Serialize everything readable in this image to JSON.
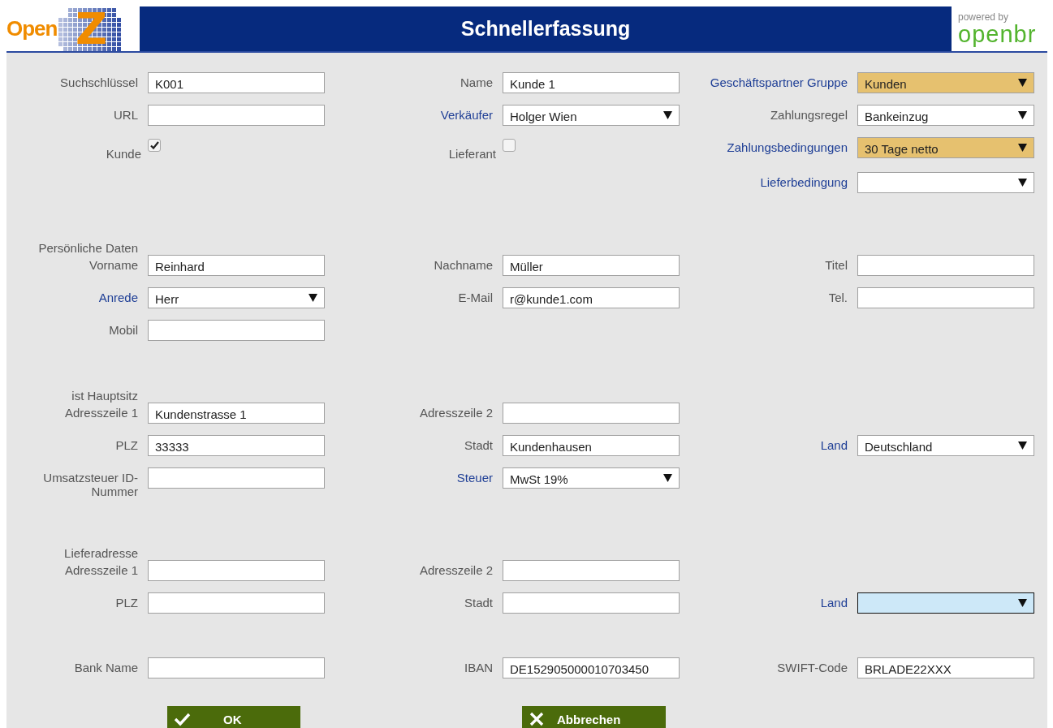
{
  "header": {
    "logo_text": "Open",
    "logo_letter": "Z",
    "title": "Schnellerfassung",
    "powered_by": "powered by",
    "partner_logo": "openbr"
  },
  "sections": [
    {
      "rows": [
        {
          "left": {
            "label": "Suchschlüssel",
            "linked": false,
            "kind": "text",
            "value": "K001"
          },
          "middle": {
            "label": "Name",
            "linked": false,
            "kind": "text",
            "value": "Kunde 1"
          },
          "right": {
            "label": "Geschäftspartner Gruppe",
            "linked": true,
            "kind": "select",
            "value": "Kunden",
            "mandatory": true,
            "focused": false
          }
        },
        {
          "left": {
            "label": "URL",
            "linked": false,
            "kind": "text"
          },
          "middle": {
            "label": "Verkäufer",
            "linked": true,
            "kind": "select",
            "value": "Holger Wien",
            "mandatory": false,
            "focused": false
          },
          "right": {
            "label": "Zahlungsregel",
            "linked": false,
            "kind": "select",
            "value": "Bankeinzug",
            "mandatory": false,
            "focused": false
          }
        },
        {
          "left": {
            "label": "Kunde",
            "linked": false,
            "kind": "checkbox",
            "checked": true
          },
          "middle": {
            "label": "Lieferant",
            "linked": false,
            "kind": "checkbox",
            "checked": false
          },
          "right": {
            "label": "Zahlungsbedingungen",
            "linked": true,
            "kind": "select",
            "value": "30 Tage netto",
            "mandatory": true,
            "focused": false
          }
        },
        {
          "right": {
            "label": "Lieferbedingung",
            "linked": true,
            "kind": "select",
            "mandatory": false,
            "focused": false
          }
        }
      ]
    },
    {
      "heading": "Persönliche Daten",
      "rows": [
        {
          "left": {
            "label": "Vorname",
            "linked": false,
            "kind": "text",
            "value": "Reinhard"
          },
          "middle": {
            "label": "Nachname",
            "linked": false,
            "kind": "text",
            "value": "Müller"
          },
          "right": {
            "label": "Titel",
            "linked": false,
            "kind": "text"
          }
        },
        {
          "left": {
            "label": "Anrede",
            "linked": true,
            "kind": "select",
            "value": "Herr",
            "mandatory": false,
            "focused": false
          },
          "middle": {
            "label": "E-Mail",
            "linked": false,
            "kind": "text",
            "value": "r@kunde1.com"
          },
          "right": {
            "label": "Tel.",
            "linked": false,
            "kind": "text"
          }
        },
        {
          "left": {
            "label": "Mobil",
            "linked": false,
            "kind": "text"
          }
        }
      ]
    },
    {
      "heading": "ist Hauptsitz",
      "rows": [
        {
          "left": {
            "label": "Adresszeile 1",
            "linked": false,
            "kind": "text",
            "value": "Kundenstrasse 1"
          },
          "middle": {
            "label": "Adresszeile 2",
            "linked": false,
            "kind": "text"
          }
        },
        {
          "left": {
            "label": "PLZ",
            "linked": false,
            "kind": "text",
            "value": "33333"
          },
          "middle": {
            "label": "Stadt",
            "linked": false,
            "kind": "text",
            "value": "Kundenhausen"
          },
          "right": {
            "label": "Land",
            "linked": true,
            "kind": "select",
            "value": "Deutschland",
            "mandatory": false,
            "focused": false
          }
        },
        {
          "left": {
            "label": "Umsatzsteuer ID-Nummer",
            "linked": false,
            "kind": "text"
          },
          "middle": {
            "label": "Steuer",
            "linked": true,
            "kind": "select",
            "value": "MwSt 19%",
            "mandatory": false,
            "focused": false
          }
        }
      ]
    },
    {
      "heading": "Lieferadresse",
      "rows": [
        {
          "left": {
            "label": "Adresszeile 1",
            "linked": false,
            "kind": "text"
          },
          "middle": {
            "label": "Adresszeile 2",
            "linked": false,
            "kind": "text"
          }
        },
        {
          "left": {
            "label": "PLZ",
            "linked": false,
            "kind": "text"
          },
          "middle": {
            "label": "Stadt",
            "linked": false,
            "kind": "text"
          },
          "right": {
            "label": "Land",
            "linked": true,
            "kind": "select",
            "mandatory": false,
            "focused": true
          }
        }
      ]
    },
    {
      "rows": [
        {
          "left": {
            "label": "Bank Name",
            "linked": false,
            "kind": "text"
          },
          "middle": {
            "label": "IBAN",
            "linked": false,
            "kind": "text",
            "value": "DE152905000010703450"
          },
          "right": {
            "label": "SWIFT-Code",
            "linked": false,
            "kind": "text",
            "value": "BRLADE22XXX"
          }
        }
      ]
    }
  ],
  "buttons": [
    {
      "label": "OK",
      "kind": "confirm"
    },
    {
      "label": "Abbrechen",
      "kind": "cancel"
    }
  ]
}
